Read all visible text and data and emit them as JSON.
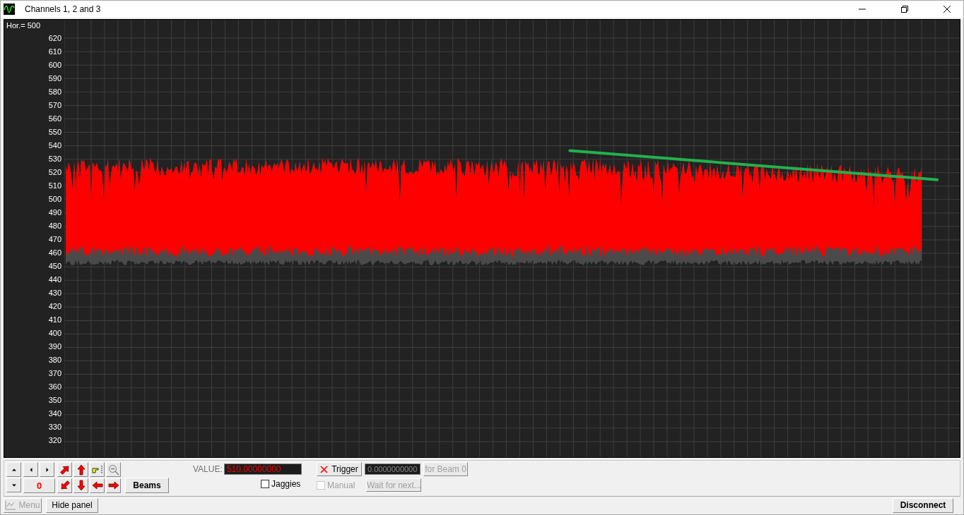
{
  "window": {
    "title": "Channels 1, 2 and 3"
  },
  "plot": {
    "scale_label": "Hor.= 500",
    "y_labels": [
      "620",
      "610",
      "600",
      "590",
      "580",
      "570",
      "560",
      "550",
      "540",
      "530",
      "520",
      "510",
      "500",
      "490",
      "480",
      "470",
      "460",
      "450",
      "440",
      "430",
      "420",
      "410",
      "400",
      "390",
      "380",
      "370",
      "360",
      "350",
      "340",
      "330",
      "320"
    ]
  },
  "panel": {
    "counter": "0",
    "beams_button": "Beams",
    "value": {
      "label": "VALUE:",
      "value": "510.00000000"
    },
    "jaggies": {
      "label": "Jaggies",
      "checked": false
    },
    "trigger": {
      "label": "Trigger"
    },
    "trigger_value": "0.0000000000",
    "for_beam": {
      "label": "for Beam 0",
      "disabled": true
    },
    "manual": {
      "label": "Manual",
      "checked": false,
      "disabled": true
    },
    "wait": {
      "label": "Wait for next...",
      "disabled": true
    }
  },
  "bottom_bar": {
    "menu": {
      "label": "Menu",
      "disabled": true
    },
    "hide_panel": {
      "label": "Hide panel"
    },
    "disconnect": {
      "label": "Disconnect"
    }
  }
}
